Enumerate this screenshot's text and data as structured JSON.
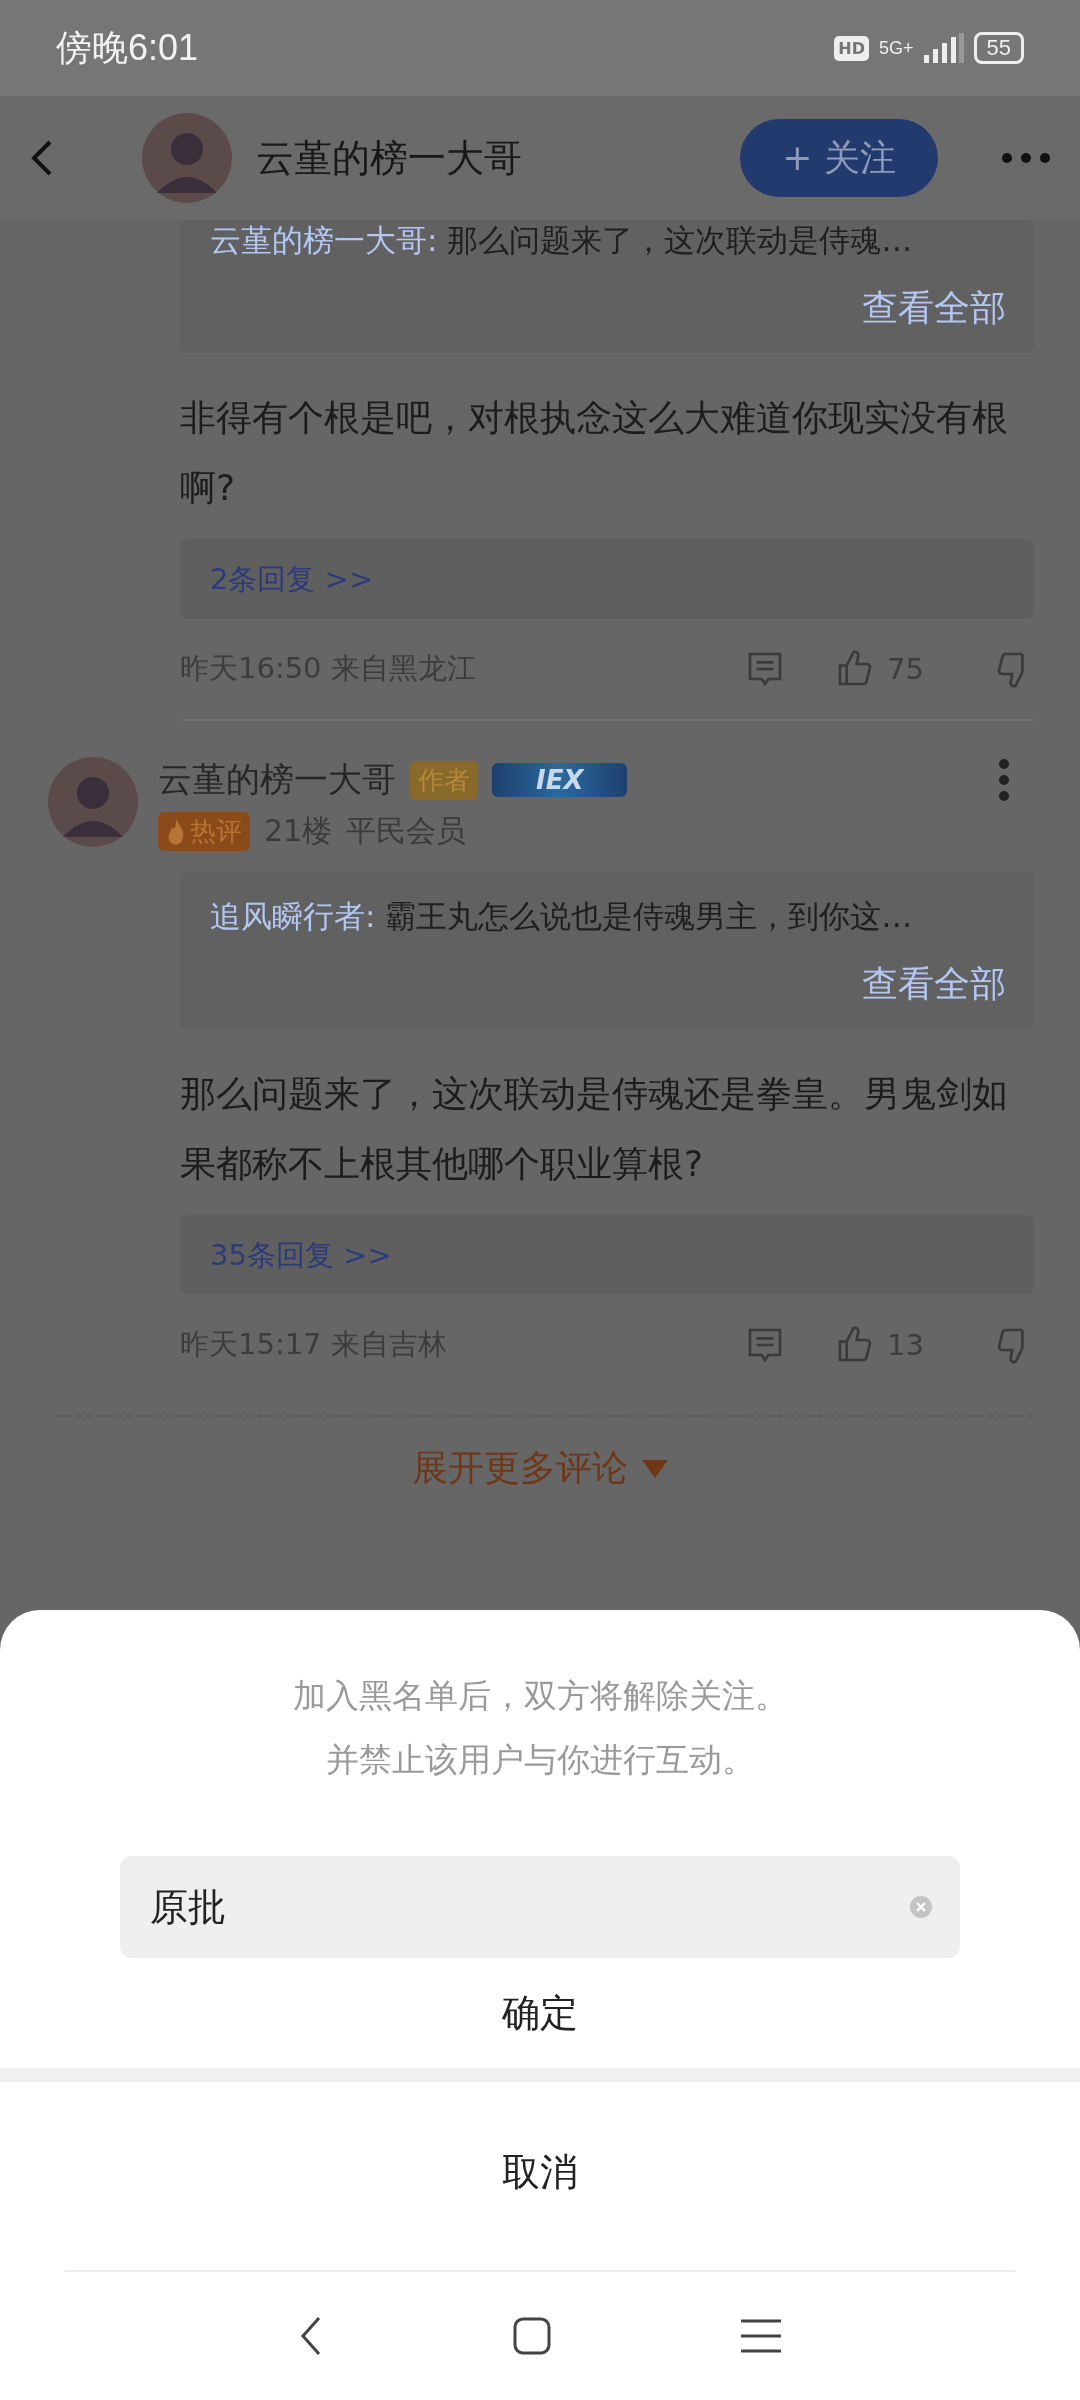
{
  "status_bar": {
    "time": "傍晚6:01",
    "hd": "HD",
    "network": "5G+",
    "battery": "55"
  },
  "header": {
    "username": "云堇的榜一大哥",
    "follow_button": "+ 关注"
  },
  "comments": [
    {
      "quote": {
        "author": "云堇的榜一大哥:",
        "text": "那么问题来了，这次联动是侍魂…",
        "view_all": "查看全部"
      },
      "body": "非得有个根是吧，对根执念这么大难道你现实没有根啊?",
      "replies": "2条回复 >>",
      "meta": "昨天16:50 来自黑龙江",
      "likes": "75"
    },
    {
      "username": "云堇的榜一大哥",
      "author_tag": "作者",
      "emblem": "IEX",
      "hot_tag": "热评",
      "floor": "21楼",
      "rank": "平民会员",
      "quote": {
        "author": "追风瞬行者:",
        "text": "霸王丸怎么说也是侍魂男主，到你这…",
        "view_all": "查看全部"
      },
      "body": "那么问题来了，这次联动是侍魂还是拳皇。男鬼剑如果都称不上根其他哪个职业算根?",
      "replies": "35条回复 >>",
      "meta": "昨天15:17 来自吉林",
      "likes": "13"
    }
  ],
  "expand_more": "展开更多评论",
  "dialog": {
    "message": [
      "加入黑名单后，双方将解除关注。",
      "并禁止该用户与你进行互动。"
    ],
    "input_value": "原批",
    "confirm": "确定",
    "cancel": "取消"
  }
}
